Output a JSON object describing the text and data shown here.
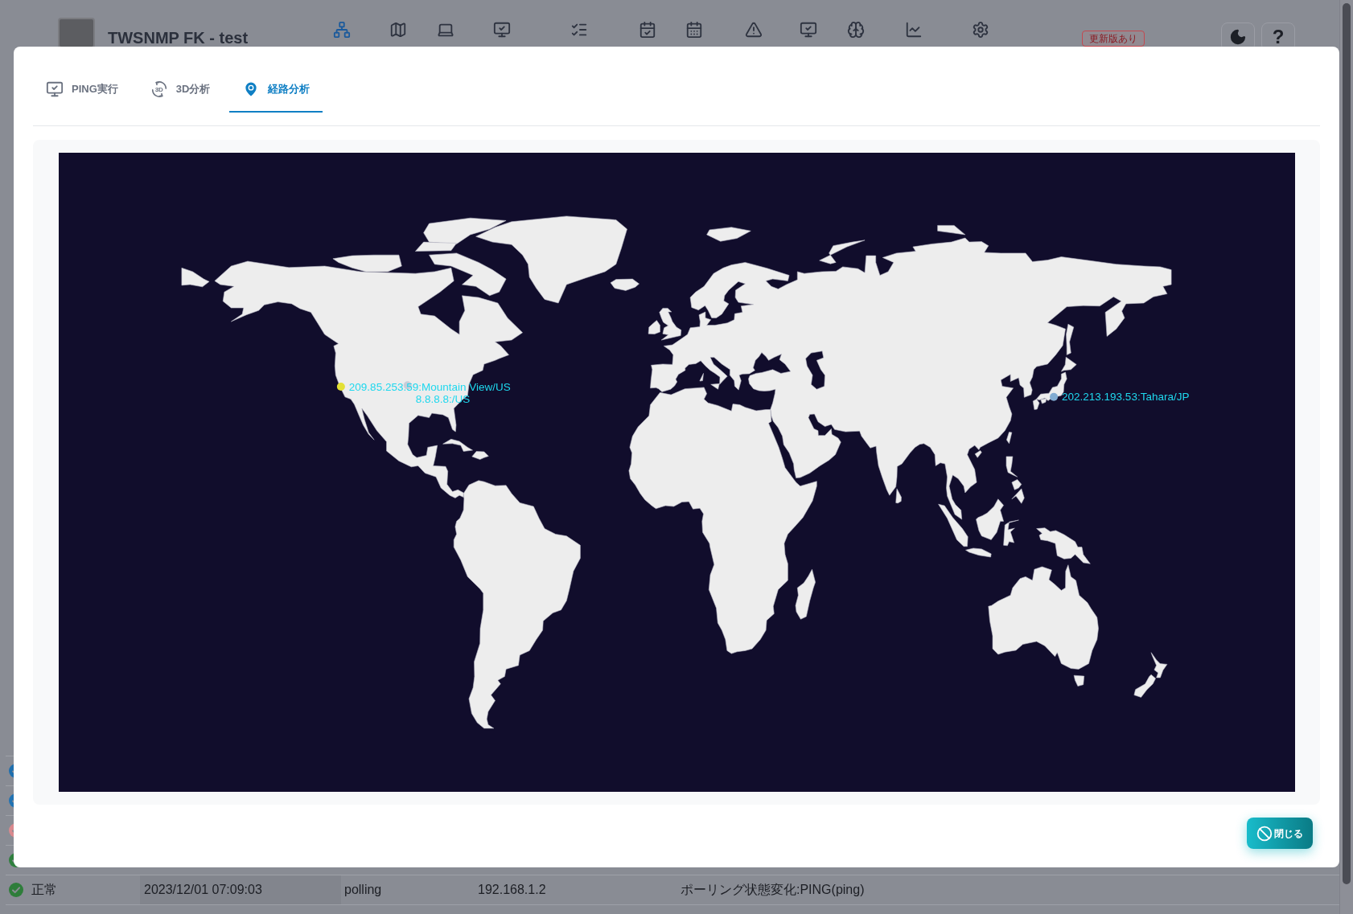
{
  "app_header": {
    "title": "TWSNMP FK - test",
    "nav": [
      {
        "selected": true
      },
      {
        "selected": false
      },
      {
        "selected": false
      },
      {
        "selected": false
      },
      {
        "selected": false
      },
      {
        "selected": false
      },
      {
        "selected": false
      },
      {
        "selected": false
      },
      {
        "selected": false
      },
      {
        "selected": false
      },
      {
        "selected": false
      },
      {
        "selected": false
      }
    ],
    "update_badge": "更新版あり",
    "help_button": "?"
  },
  "dialog": {
    "tabs": [
      {
        "label": "PING実行",
        "selected": false
      },
      {
        "label": "3D分析",
        "selected": false,
        "icon_text": "3D"
      },
      {
        "label": "経路分析",
        "selected": true
      }
    ],
    "map": {
      "markers": [
        {
          "label": "209.85.253.59:Mountain View/US",
          "color": "#e3e035"
        },
        {
          "label": "8.8.8.8:/US",
          "color": "#c8cdd8"
        },
        {
          "label": "202.213.193.53:Tahara/JP",
          "color": "#82acd2"
        }
      ]
    },
    "close_button": "閉じる"
  },
  "event_log": {
    "rows": [
      {
        "color": "#1f6fae"
      },
      {
        "color": "#2273b3"
      },
      {
        "color": "#d9898e"
      },
      {
        "color": "#2f7f3e"
      },
      {
        "color": "#2e7d3a",
        "status": "正常",
        "time": "2023/12/01 07:09:03",
        "type": "polling",
        "ip": "192.168.1.2",
        "message": "ポーリング状態変化:PING(ping)"
      }
    ]
  }
}
